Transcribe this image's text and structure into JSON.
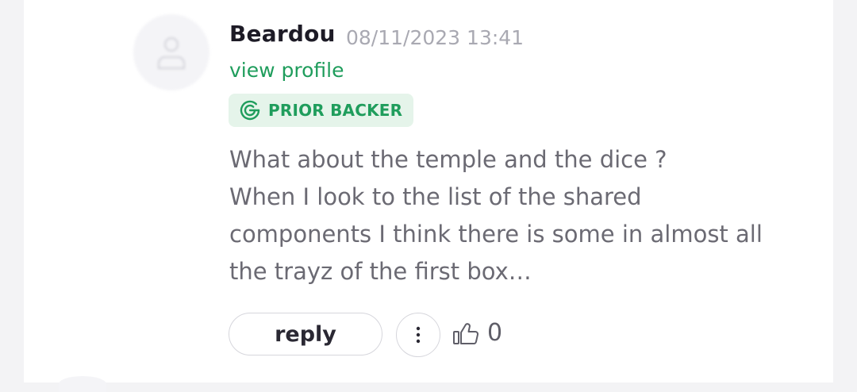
{
  "comment": {
    "author": "Beardou",
    "timestamp": "08/11/2023 13:41",
    "profile_link": "view profile",
    "badge": {
      "label": "PRIOR BACKER",
      "icon": "gamefound-logo-icon",
      "color": "#1f9d5c"
    },
    "body_lines": [
      "What about the temple and the dice ?",
      "When I look to the list of the shared",
      "components I think there is some in almost all",
      "the trayz of the first box…"
    ],
    "actions": {
      "reply_label": "reply",
      "more_icon": "more-vertical-icon",
      "like_icon": "thumbs-up-icon",
      "like_count": "0"
    }
  }
}
